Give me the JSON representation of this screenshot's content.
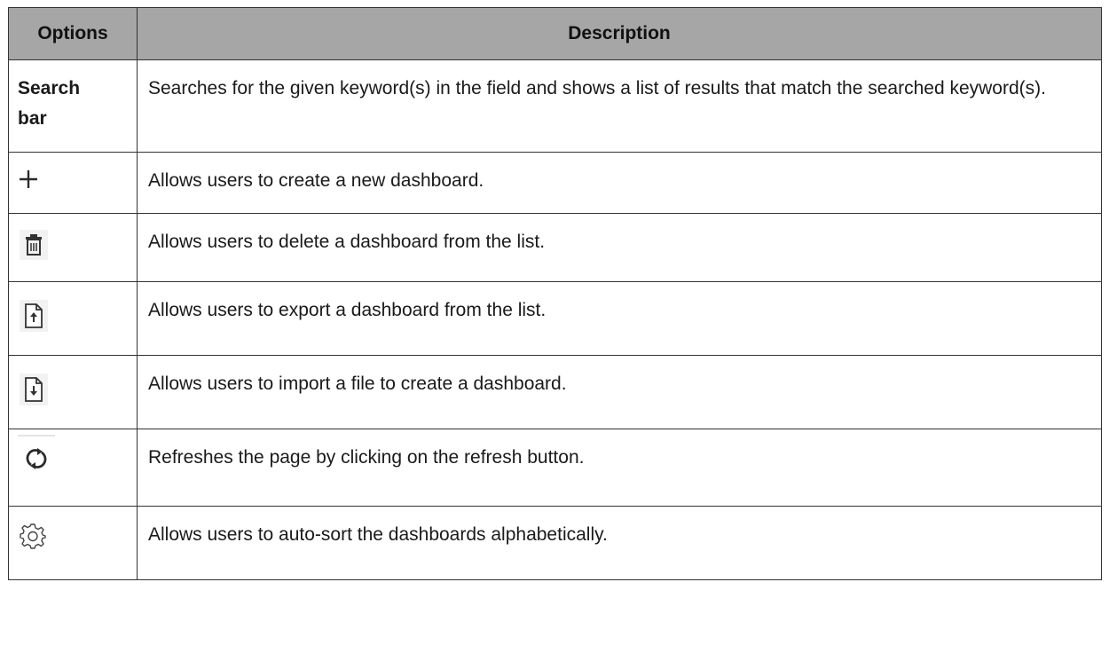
{
  "table": {
    "headers": {
      "options": "Options",
      "description": "Description"
    },
    "rows": [
      {
        "option_text": "Search bar",
        "option_line1": "Search",
        "option_line2": "bar",
        "description": "Searches for the given keyword(s) in the field and shows a list of results that match the searched keyword(s)."
      },
      {
        "icon": "plus-icon",
        "description": "Allows users to create a new dashboard."
      },
      {
        "icon": "trash-icon",
        "description": "Allows users to delete a dashboard from the list."
      },
      {
        "icon": "export-file-icon",
        "description": "Allows users to export a dashboard from the list."
      },
      {
        "icon": "import-file-icon",
        "description": "Allows users to import a file to create a dashboard."
      },
      {
        "icon": "refresh-icon",
        "description": "Refreshes the page by clicking on the refresh button."
      },
      {
        "icon": "gear-icon",
        "description": "Allows users to auto-sort the dashboards alphabetically."
      }
    ]
  },
  "colors": {
    "header_background": "#a6a6a6",
    "border": "#333333",
    "icon_color": "#333333"
  }
}
